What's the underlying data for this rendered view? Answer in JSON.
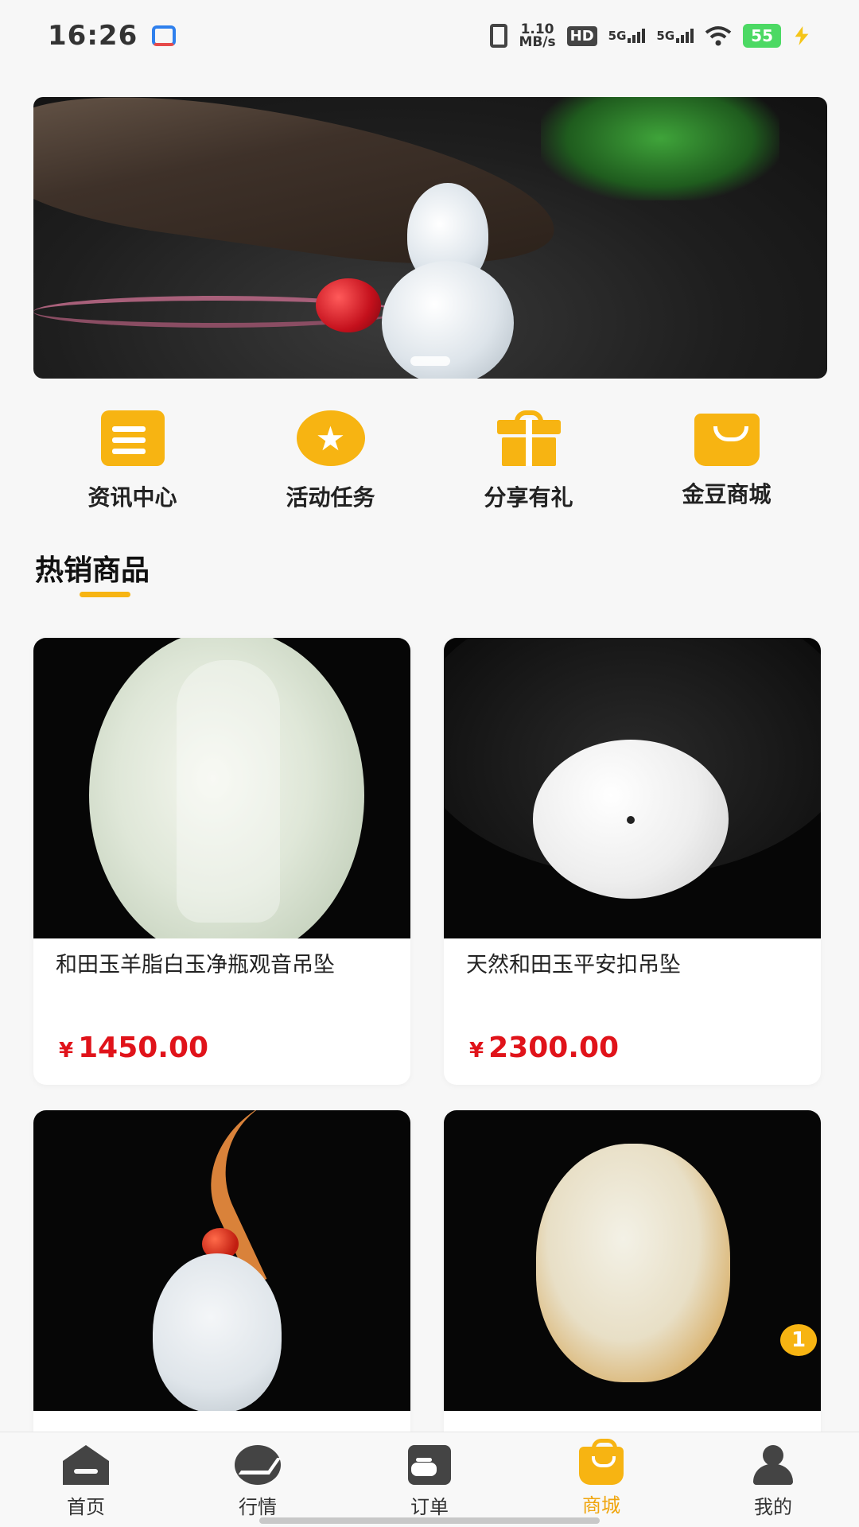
{
  "status_bar": {
    "time": "16:26",
    "net_speed_value": "1.10",
    "net_speed_unit": "MB/s",
    "hd_label": "HD",
    "signal_1": "5G",
    "signal_2": "5G",
    "battery": "55",
    "icons": [
      "app-notification-icon",
      "vibrate-icon",
      "hd-icon",
      "5g-signal-icon",
      "wifi-icon",
      "battery-icon",
      "charging-icon"
    ]
  },
  "banner": {
    "active_slide": 1
  },
  "quick_nav": [
    {
      "label": "资讯中心",
      "icon": "news-icon"
    },
    {
      "label": "活动任务",
      "icon": "star-icon"
    },
    {
      "label": "分享有礼",
      "icon": "gift-icon"
    },
    {
      "label": "金豆商城",
      "icon": "shopping-bag-icon"
    }
  ],
  "section": {
    "title": "热销商品"
  },
  "products": [
    {
      "name": "和田玉羊脂白玉净瓶观音吊坠",
      "currency": "¥",
      "price": "1450.00"
    },
    {
      "name": "天然和田玉平安扣吊坠",
      "currency": "¥",
      "price": "2300.00"
    },
    {
      "name": "",
      "currency": "",
      "price": ""
    },
    {
      "name": "",
      "currency": "",
      "price": ""
    }
  ],
  "badge": {
    "count": "1"
  },
  "bottom_nav": [
    {
      "label": "首页",
      "icon": "home-icon"
    },
    {
      "label": "行情",
      "icon": "trend-icon"
    },
    {
      "label": "订单",
      "icon": "order-icon"
    },
    {
      "label": "商城",
      "icon": "shop-icon",
      "active": true
    },
    {
      "label": "我的",
      "icon": "user-icon"
    }
  ],
  "colors": {
    "accent": "#f7b412",
    "price": "#e0131a",
    "active_tab": "#f0a50c"
  }
}
